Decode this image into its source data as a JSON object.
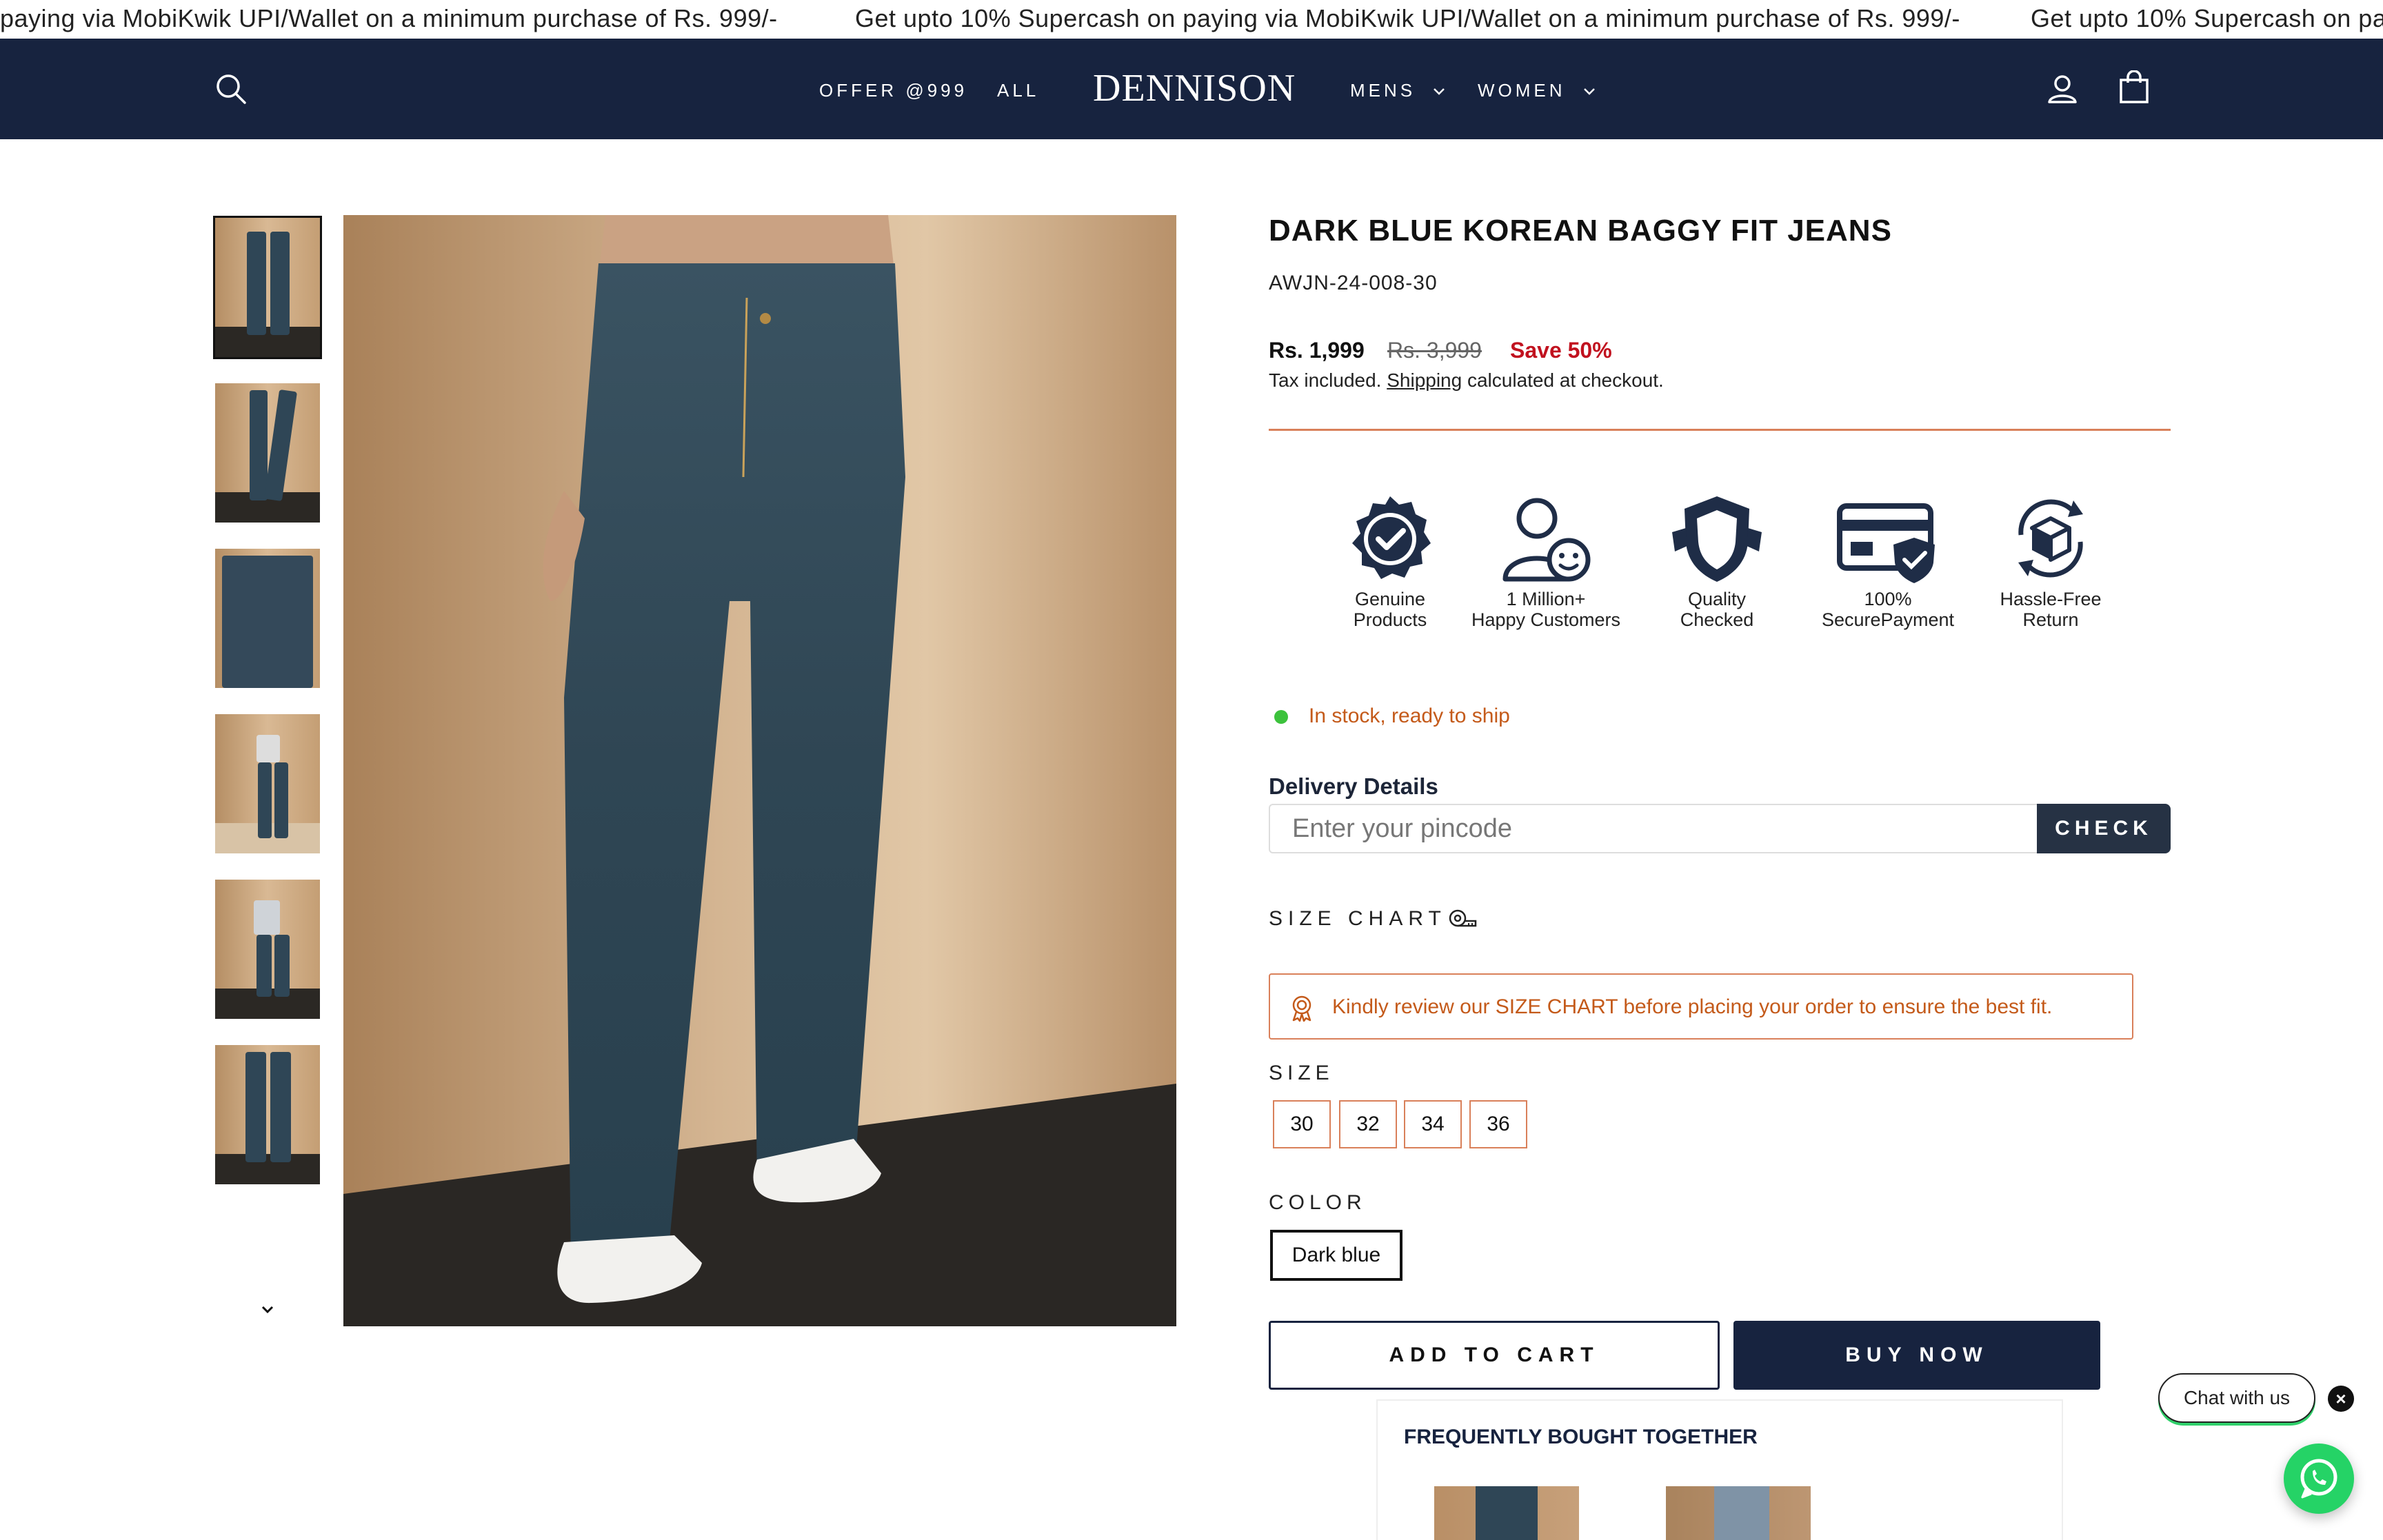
{
  "announcement": {
    "messages": [
      "paying via MobiKwik UPI/Wallet on a minimum purchase of Rs. 999/-",
      "Get upto 10% Supercash on paying via MobiKwik UPI/Wallet on a minimum purchase of Rs. 999/-",
      "Get upto 10% Supercash on pa"
    ]
  },
  "header": {
    "logo": "DENNISON",
    "nav": {
      "offer": "OFFER @999",
      "all": "ALL",
      "mens": "MENS",
      "women": "WOMEN"
    },
    "icons": [
      "search-icon",
      "account-icon",
      "cart-icon"
    ],
    "background_color": "#17233f"
  },
  "gallery": {
    "thumbnail_count": 6,
    "active_index": 0
  },
  "product": {
    "title": "DARK BLUE KOREAN BAGGY FIT JEANS",
    "sku": "AWJN-24-008-30",
    "price": "Rs. 1,999",
    "compare_price": "Rs. 3,999",
    "save": "Save 50%",
    "tax_prefix": "Tax included.",
    "tax_link": "Shipping",
    "tax_suffix": "calculated at checkout."
  },
  "badges": [
    {
      "line1": "Genuine",
      "line2": "Products",
      "icon": "verified-badge-icon"
    },
    {
      "line1": "1 Million+",
      "line2": "Happy Customers",
      "icon": "happy-customer-icon"
    },
    {
      "line1": "Quality",
      "line2": "Checked",
      "icon": "quality-shield-icon"
    },
    {
      "line1": "100%",
      "line2": "SecurePayment",
      "icon": "secure-payment-icon"
    },
    {
      "line1": "Hassle-Free",
      "line2": "Return",
      "icon": "return-box-icon"
    }
  ],
  "stock": {
    "text": "In stock, ready to ship",
    "color": "#3cc23c"
  },
  "delivery": {
    "label": "Delivery Details",
    "placeholder": "Enter your pincode",
    "button": "CHECK"
  },
  "size_chart": {
    "label": "SIZE CHART",
    "notice": "Kindly review our SIZE CHART before placing your order to ensure the best fit."
  },
  "size": {
    "label": "SIZE",
    "options": [
      "30",
      "32",
      "34",
      "36"
    ]
  },
  "color": {
    "label": "COLOR",
    "selected": "Dark blue"
  },
  "actions": {
    "add_to_cart": "ADD TO CART",
    "buy_now": "BUY NOW"
  },
  "fbt": {
    "title": "FREQUENTLY BOUGHT TOGETHER"
  },
  "chat": {
    "label": "Chat with us",
    "close": "×"
  },
  "colors": {
    "accent_orange": "#d9805a",
    "sale_red": "#c1121f",
    "navy": "#17233f",
    "whatsapp_green": "#25d366"
  }
}
